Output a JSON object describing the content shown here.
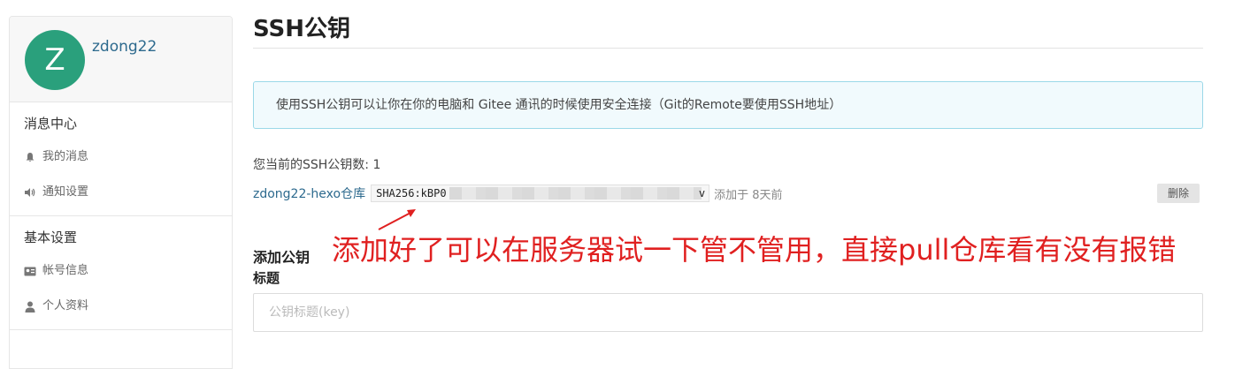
{
  "user": {
    "avatar_letter": "Z",
    "name": "zdong22"
  },
  "sidebar": {
    "sections": [
      {
        "title": "消息中心",
        "items": [
          {
            "label": "我的消息",
            "icon": "bell-icon"
          },
          {
            "label": "通知设置",
            "icon": "speaker-icon"
          }
        ]
      },
      {
        "title": "基本设置",
        "items": [
          {
            "label": "帐号信息",
            "icon": "id-card-icon"
          },
          {
            "label": "个人资料",
            "icon": "user-icon"
          }
        ]
      }
    ]
  },
  "main": {
    "title": "SSH公钥",
    "info": "使用SSH公钥可以让你在你的电脑和 Gitee 通讯的时候使用安全连接（Git的Remote要使用SSH地址）",
    "key_count": "您当前的SSH公钥数: 1",
    "key": {
      "name": "zdong22-hexo仓库",
      "fingerprint_prefix": "SHA256:kBP0",
      "fingerprint_suffix": "v",
      "added": "添加于 8天前",
      "delete_label": "删除"
    },
    "add_title": "添加公钥",
    "annotation": "添加好了可以在服务器试一下管不管用，直接pull仓库看有没有报错",
    "field_label": "标题",
    "field_placeholder": "公钥标题(key)"
  },
  "colors": {
    "accent": "#2aa07c",
    "link": "#2d6a8e",
    "annotation": "#e02020",
    "alert_bg": "#f1fafd",
    "alert_border": "#9bd8e8"
  }
}
